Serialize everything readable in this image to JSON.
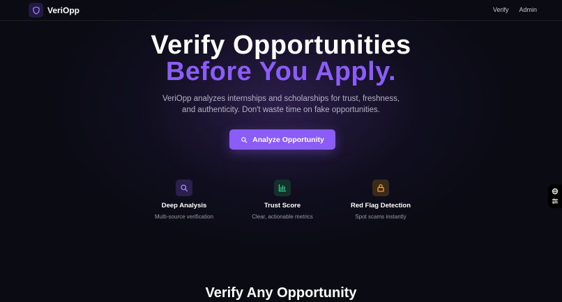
{
  "nav": {
    "brand": "VeriOpp",
    "links": [
      "Verify",
      "Admin"
    ]
  },
  "hero": {
    "title_line1": "Verify Opportunities",
    "title_line2": "Before You Apply.",
    "subtitle_line1": "VeriOpp analyzes internships and scholarships for trust, freshness,",
    "subtitle_line2": "and authenticity. Don't waste time on fake opportunities.",
    "cta_label": "Analyze Opportunity"
  },
  "features": [
    {
      "title": "Deep Analysis",
      "desc": "Multi-source verification",
      "icon": "search-icon"
    },
    {
      "title": "Trust Score",
      "desc": "Clear, actionable metrics",
      "icon": "bar-chart-icon"
    },
    {
      "title": "Red Flag Detection",
      "desc": "Spot scams instantly",
      "icon": "lock-icon"
    }
  ],
  "section": {
    "title": "Verify Any Opportunity"
  },
  "colors": {
    "accent": "#8b5cf6",
    "background": "#0b0b14",
    "trust_green": "#34d399",
    "flag_orange": "#f5a623"
  }
}
